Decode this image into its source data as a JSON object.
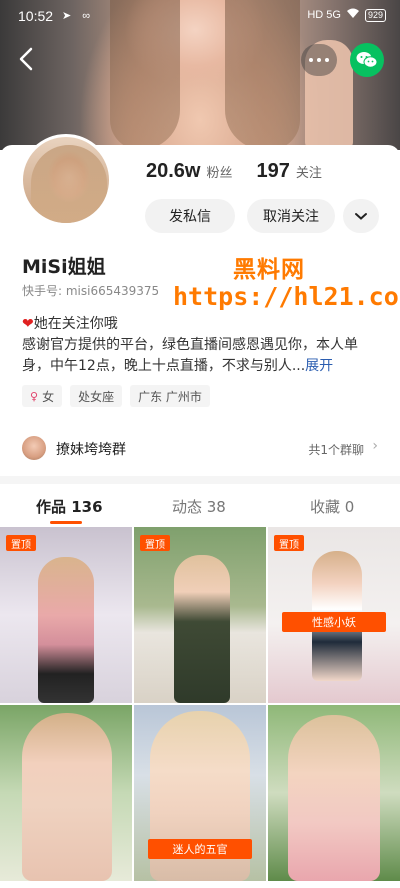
{
  "status_bar": {
    "time": "10:52",
    "left_icons": "➤ ∞",
    "network": "HD 5G",
    "wifi": "WiFi",
    "battery": "929"
  },
  "header": {
    "back_icon": "chevron-left-icon",
    "more_icon": "ellipsis-icon",
    "share_icon": "wechat-icon"
  },
  "profile": {
    "followers_count": "20.6w",
    "followers_label": "粉丝",
    "following_count": "197",
    "following_label": "关注",
    "message_button": "发私信",
    "unfollow_button": "取消关注",
    "expand_icon": "chevron-down-icon",
    "nickname": "MiSi姐姐",
    "kuaishou_id": "快手号: misi665439375",
    "status_line": "她在关注你哦",
    "bio_text": "感谢官方提供的平台，绿色直播间感恩遇见你，本人单身，中午12点，晚上十点直播，不求与别人...",
    "bio_expand": "展开",
    "tags": [
      {
        "label": "女",
        "icon": "female-icon"
      },
      {
        "label": "处女座"
      },
      {
        "label": "广东 广州市"
      }
    ]
  },
  "watermark": {
    "line1": "黑料网",
    "line2": "https://hl21.co"
  },
  "group": {
    "name": "撩妹垮垮群",
    "count": "共1个群聊",
    "chevron": "›"
  },
  "tabs": [
    {
      "label": "作品 136",
      "active": true
    },
    {
      "label": "动态 38",
      "active": false
    },
    {
      "label": "收藏 0",
      "active": false
    }
  ],
  "grid": [
    {
      "pin": "置顶"
    },
    {
      "pin": "置顶"
    },
    {
      "pin": "置顶",
      "caption": "性感小妖"
    },
    {},
    {
      "caption": "迷人的五官"
    },
    {}
  ],
  "colors": {
    "accent": "#ff5000",
    "wechat": "#07c160",
    "link": "#2a5db0",
    "watermark": "#ff7a00"
  }
}
